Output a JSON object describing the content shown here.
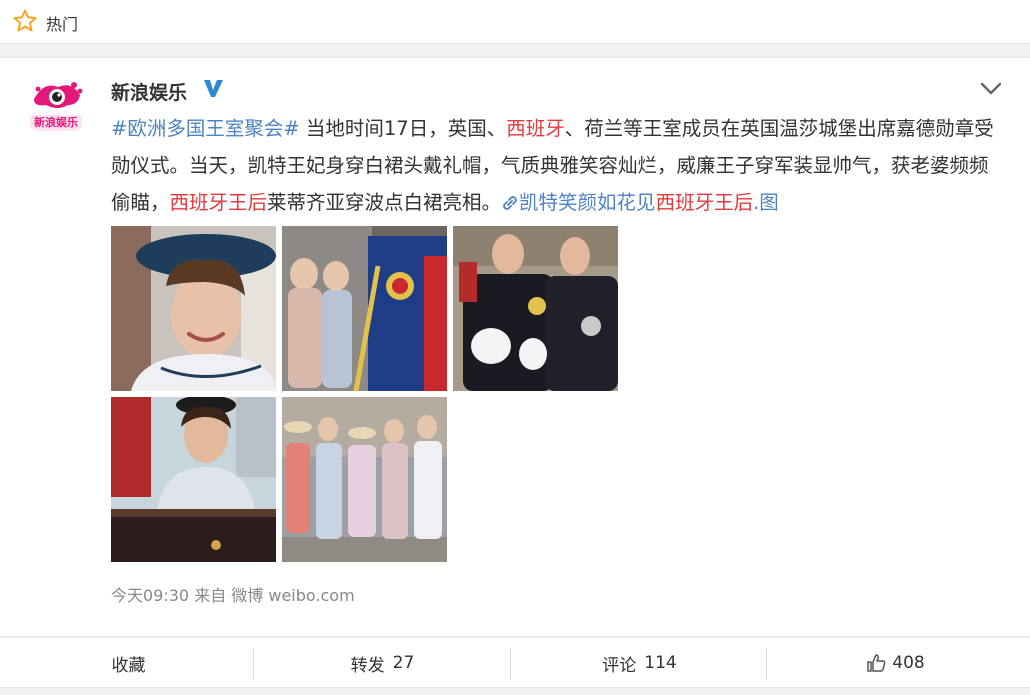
{
  "header": {
    "icon": "star-icon",
    "label": "热门"
  },
  "post": {
    "author": "新浪娱乐",
    "avatar_text": "新浪娱乐",
    "verified": true,
    "text": {
      "topic": "#欧洲多国王室聚会#",
      "p1": " 当地时间17日，英国、",
      "kw1": "西班牙",
      "p2": "、荷兰等王室成员在英国温莎城堡出席嘉德勋章受勋仪式。当天，凯特王妃身穿白裙头戴礼帽，气质典雅笑容灿烂，威廉王子穿军装显帅气，获老婆频频偷瞄，",
      "kw2": "西班牙王后",
      "p3": "莱蒂齐亚穿波点白裙亮相。",
      "link_pre": "凯特笑颜如花见",
      "link_kw": "西班牙王后",
      "link_post": ".图"
    },
    "photos": [
      {
        "name": "photo-kate-smiling"
      },
      {
        "name": "photo-royals-procession"
      },
      {
        "name": "photo-william-and-felipe"
      },
      {
        "name": "photo-queen-letizia-carriage"
      },
      {
        "name": "photo-royal-ladies-group"
      }
    ],
    "meta": "今天09:30 来自 微博 weibo.com"
  },
  "actions": {
    "favorite": "收藏",
    "repost": "转发",
    "repost_count": "27",
    "comment": "评论",
    "comment_count": "114",
    "like_count": "408"
  },
  "colors": {
    "link": "#4e83c3",
    "keyword": "#e4393c",
    "verified": "#2b8bd1",
    "star": "#f5a623"
  }
}
